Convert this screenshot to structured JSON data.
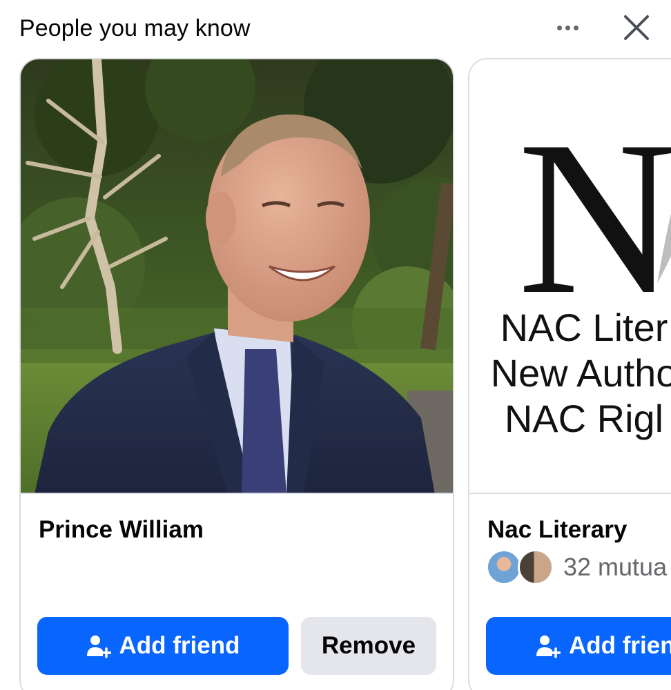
{
  "header": {
    "title": "People you may know",
    "more_icon": "more-horizontal-icon",
    "close_icon": "close-icon"
  },
  "cards": [
    {
      "name": "Prince William",
      "photo_icon": "profile-photo",
      "add_label": "Add friend",
      "remove_label": "Remove"
    },
    {
      "name": "Nac Literary",
      "photo_logo_letter": "N",
      "photo_logo_lines": [
        "NAC Liter",
        "New Autho",
        "NAC Rigl"
      ],
      "mutual_text": "32 mutua",
      "add_label": "Add frien"
    }
  ],
  "colors": {
    "accent": "#0866ff",
    "secondary_button": "#e4e6eb",
    "muted_text": "#65676b",
    "border": "#dadde1"
  }
}
